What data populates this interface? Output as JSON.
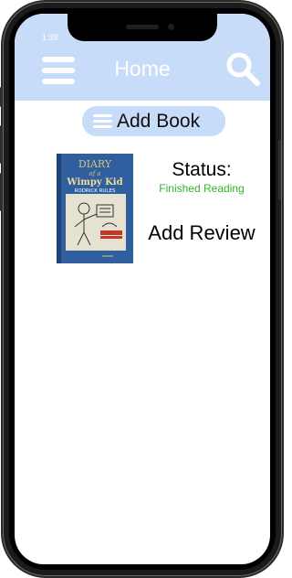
{
  "status_bar": {
    "time": "1:38"
  },
  "header": {
    "title": "Home",
    "menu_icon": "hamburger-menu-icon",
    "search_icon": "magnifier-icon",
    "background": "#c7dcf8"
  },
  "actions": {
    "add_book_label": "Add Book",
    "add_book_icon": "list-icon"
  },
  "book": {
    "cover_text": {
      "line1": "DIARY",
      "line2": "of a",
      "line3": "Wimpy Kid",
      "line4": "RODRICK RULES"
    },
    "status_label": "Status:",
    "status_value": "Finished Reading",
    "status_color": "#2fb52f",
    "review_label": "Add Review"
  }
}
